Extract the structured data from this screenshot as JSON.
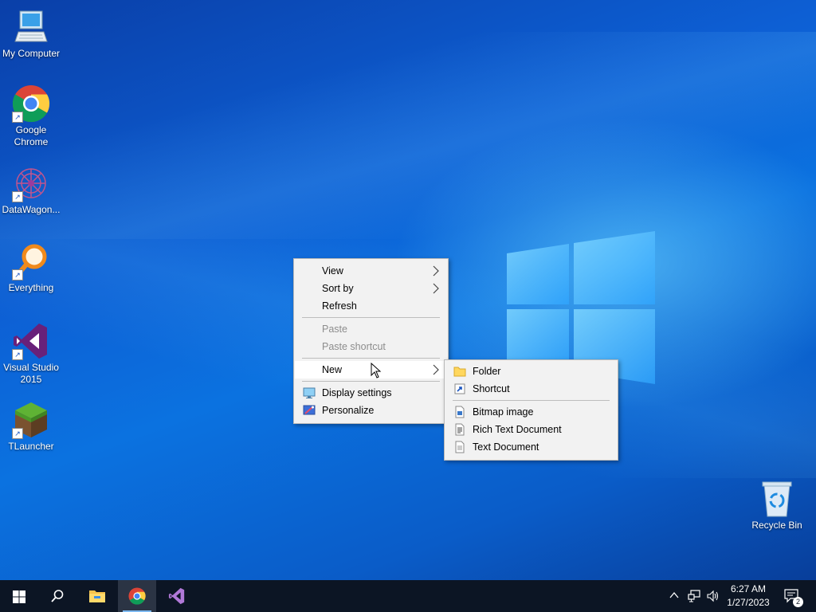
{
  "desktop_icons": [
    {
      "id": "my-computer",
      "label": "My Computer",
      "icon": "computer-icon",
      "shortcut": false
    },
    {
      "id": "google-chrome",
      "label": "Google Chrome",
      "icon": "chrome-icon",
      "shortcut": true
    },
    {
      "id": "datawagon",
      "label": "DataWagon...",
      "icon": "datawagon-icon",
      "shortcut": true
    },
    {
      "id": "everything",
      "label": "Everything",
      "icon": "everything-search-icon",
      "shortcut": true
    },
    {
      "id": "visual-studio",
      "label": "Visual Studio 2015",
      "icon": "visual-studio-icon",
      "shortcut": true
    },
    {
      "id": "tlauncher",
      "label": "TLauncher",
      "icon": "tlauncher-icon",
      "shortcut": true
    },
    {
      "id": "recycle-bin",
      "label": "Recycle Bin",
      "icon": "recycle-bin-icon",
      "shortcut": false
    }
  ],
  "context_menu": {
    "items": [
      {
        "label": "View",
        "submenu": true,
        "enabled": true
      },
      {
        "label": "Sort by",
        "submenu": true,
        "enabled": true
      },
      {
        "label": "Refresh",
        "submenu": false,
        "enabled": true
      },
      {
        "label": "Paste",
        "submenu": false,
        "enabled": false
      },
      {
        "label": "Paste shortcut",
        "submenu": false,
        "enabled": false
      },
      {
        "label": "New",
        "submenu": true,
        "enabled": true,
        "highlighted": true
      },
      {
        "label": "Display settings",
        "icon": "display-settings-icon",
        "enabled": true
      },
      {
        "label": "Personalize",
        "icon": "personalize-icon",
        "enabled": true
      }
    ]
  },
  "new_submenu": {
    "items": [
      {
        "label": "Folder",
        "icon": "folder-icon"
      },
      {
        "label": "Shortcut",
        "icon": "shortcut-icon"
      },
      {
        "label": "Bitmap image",
        "icon": "bitmap-image-icon"
      },
      {
        "label": "Rich Text Document",
        "icon": "rich-text-document-icon"
      },
      {
        "label": "Text Document",
        "icon": "text-document-icon"
      }
    ]
  },
  "taskbar": {
    "pinned": [
      {
        "name": "start-button",
        "icon": "windows-start-icon"
      },
      {
        "name": "search-button",
        "icon": "search-icon"
      },
      {
        "name": "file-explorer",
        "icon": "file-explorer-icon"
      },
      {
        "name": "chrome",
        "icon": "chrome-icon",
        "running": true
      },
      {
        "name": "visual-studio",
        "icon": "visual-studio-icon"
      }
    ],
    "tray": {
      "time": "6:27 AM",
      "date": "1/27/2023",
      "notification_count": "2"
    }
  },
  "colors": {
    "accent": "#0b72e0",
    "taskbar": "#0c1524",
    "menu_bg": "#f2f2f2"
  }
}
